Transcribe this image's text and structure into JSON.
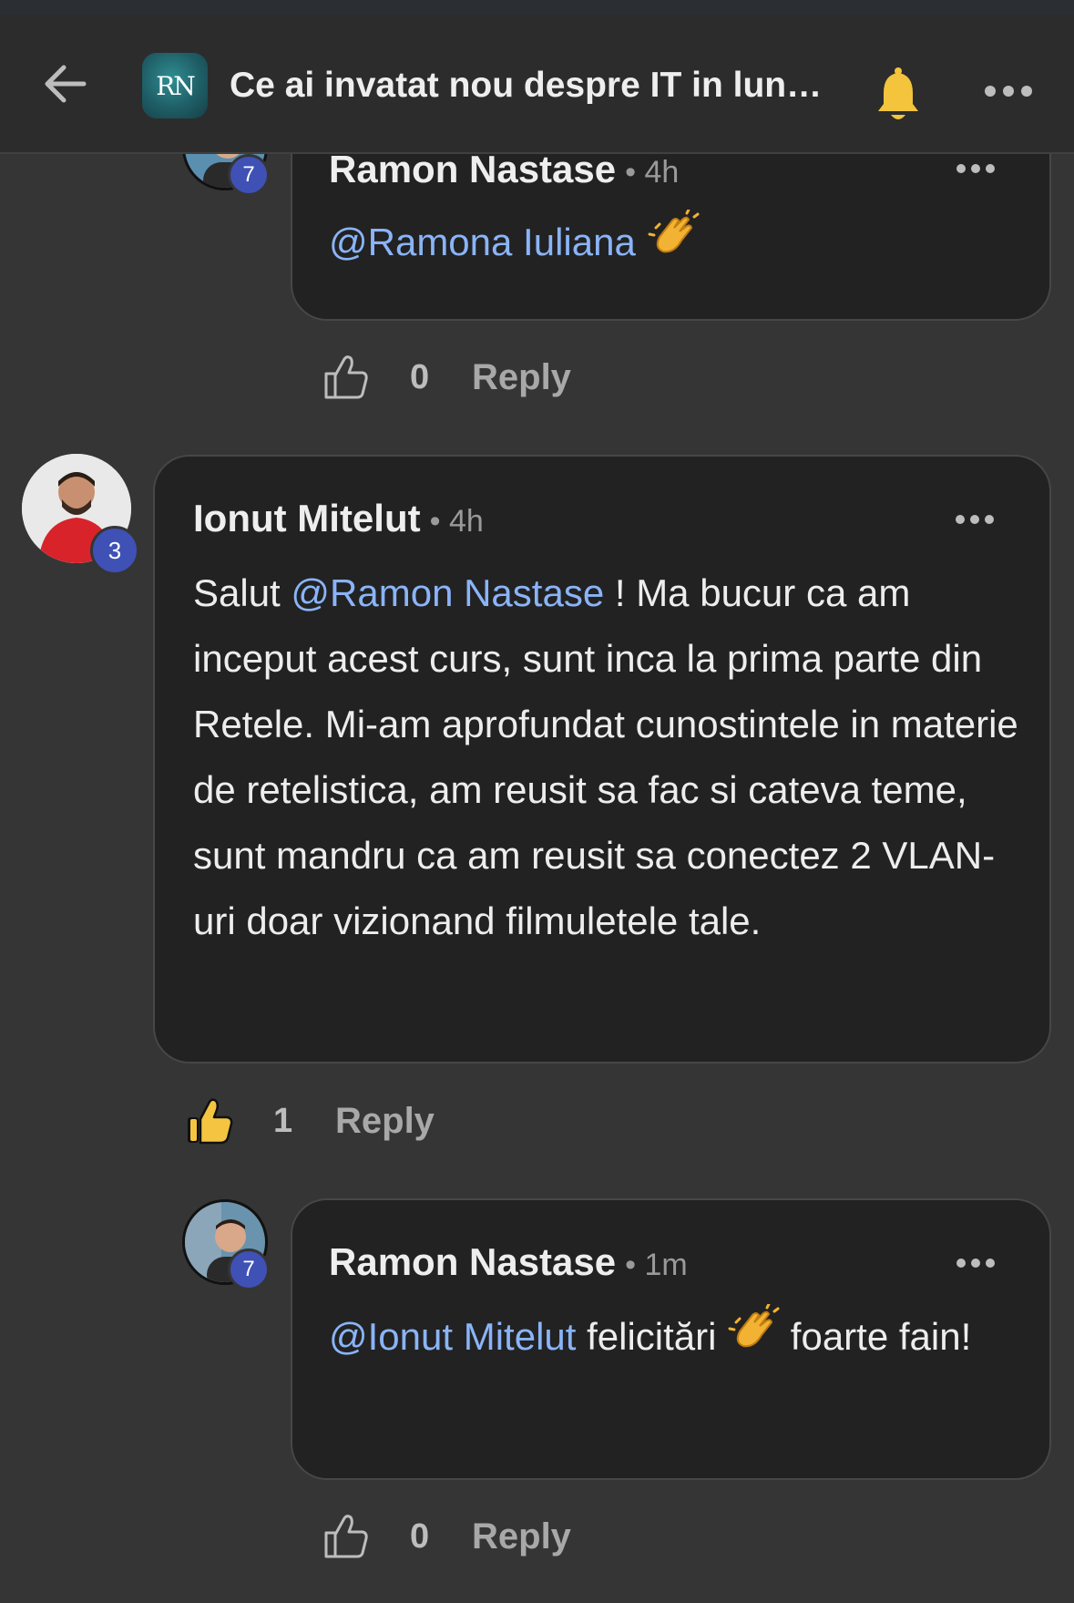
{
  "topbar": {
    "title": "Ce ai invatat nou despre IT in luna…",
    "logo_text": "RN",
    "icons": {
      "back": "arrow-left-icon",
      "bell": "bell-icon",
      "more": "more-horizontal-icon"
    }
  },
  "comments": [
    {
      "author": "Ramon Nastase",
      "time": "• 4h",
      "level": "7",
      "mention": "@Ramona Iuliana",
      "text_after": "",
      "text_tail": "",
      "likes": "0",
      "liked": false,
      "reply_label": "Reply"
    },
    {
      "author": "Ionut Mitelut",
      "time": "• 4h",
      "level": "3",
      "text_before": "Salut ",
      "mention": "@Ramon Nastase",
      "text_after": " ! Ma bucur ca am inceput acest curs, sunt inca la prima parte din Retele. Mi-am aprofundat cunostintele in materie de retelistica, am reusit sa fac si cateva teme, sunt mandru ca am reusit sa conectez 2 VLAN-uri doar vizionand filmuletele tale.",
      "likes": "1",
      "liked": true,
      "reply_label": "Reply"
    },
    {
      "author": "Ramon Nastase",
      "time": "• 1m",
      "level": "7",
      "mention": "@Ionut Mitelut",
      "text_after": " felicitări ",
      "text_tail": " foarte fain!",
      "likes": "0",
      "liked": false,
      "reply_label": "Reply"
    }
  ],
  "colors": {
    "mention": "#8ab4f8",
    "badge": "#3f51b5",
    "bubble": "#222222",
    "background": "#353535",
    "liked": "#f5c542"
  }
}
